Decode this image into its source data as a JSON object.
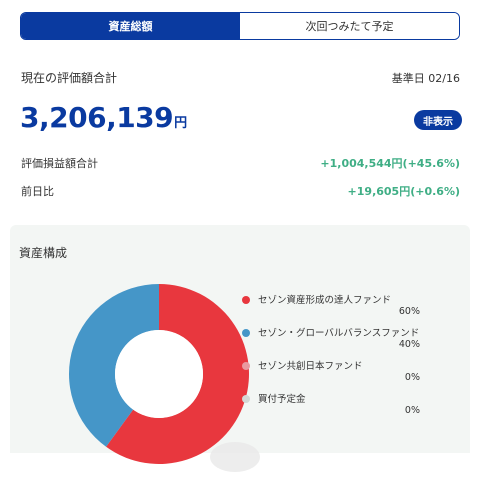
{
  "tabs": [
    {
      "label": "資産総額",
      "active": true
    },
    {
      "label": "次回つみたて予定",
      "active": false
    }
  ],
  "summary": {
    "total_label": "現在の評価額合計",
    "base_date": "基準日 02/16",
    "total_amount": "3,206,139",
    "total_unit": "円",
    "hide_button": "非表示",
    "pl_label": "評価損益額合計",
    "pl_value": "+1,004,544円(+45.6%)",
    "day_change_label": "前日比",
    "day_change_value": "+19,605円(+0.6%)",
    "positive_color": "#3fae85",
    "accent_color": "#0a3aa0"
  },
  "allocation": {
    "title": "資産構成",
    "items": [
      {
        "name": "セゾン資産形成の達人ファンド",
        "percent": "60%",
        "value": 60,
        "color": "#e8373e"
      },
      {
        "name": "セゾン・グローバルバランスファンド",
        "percent": "40%",
        "value": 40,
        "color": "#4596c8"
      },
      {
        "name": "セゾン共創日本ファンド",
        "percent": "0%",
        "value": 0,
        "color": "#e99aa0"
      },
      {
        "name": "買付予定金",
        "percent": "0%",
        "value": 0,
        "color": "#d4d8d6"
      }
    ]
  }
}
